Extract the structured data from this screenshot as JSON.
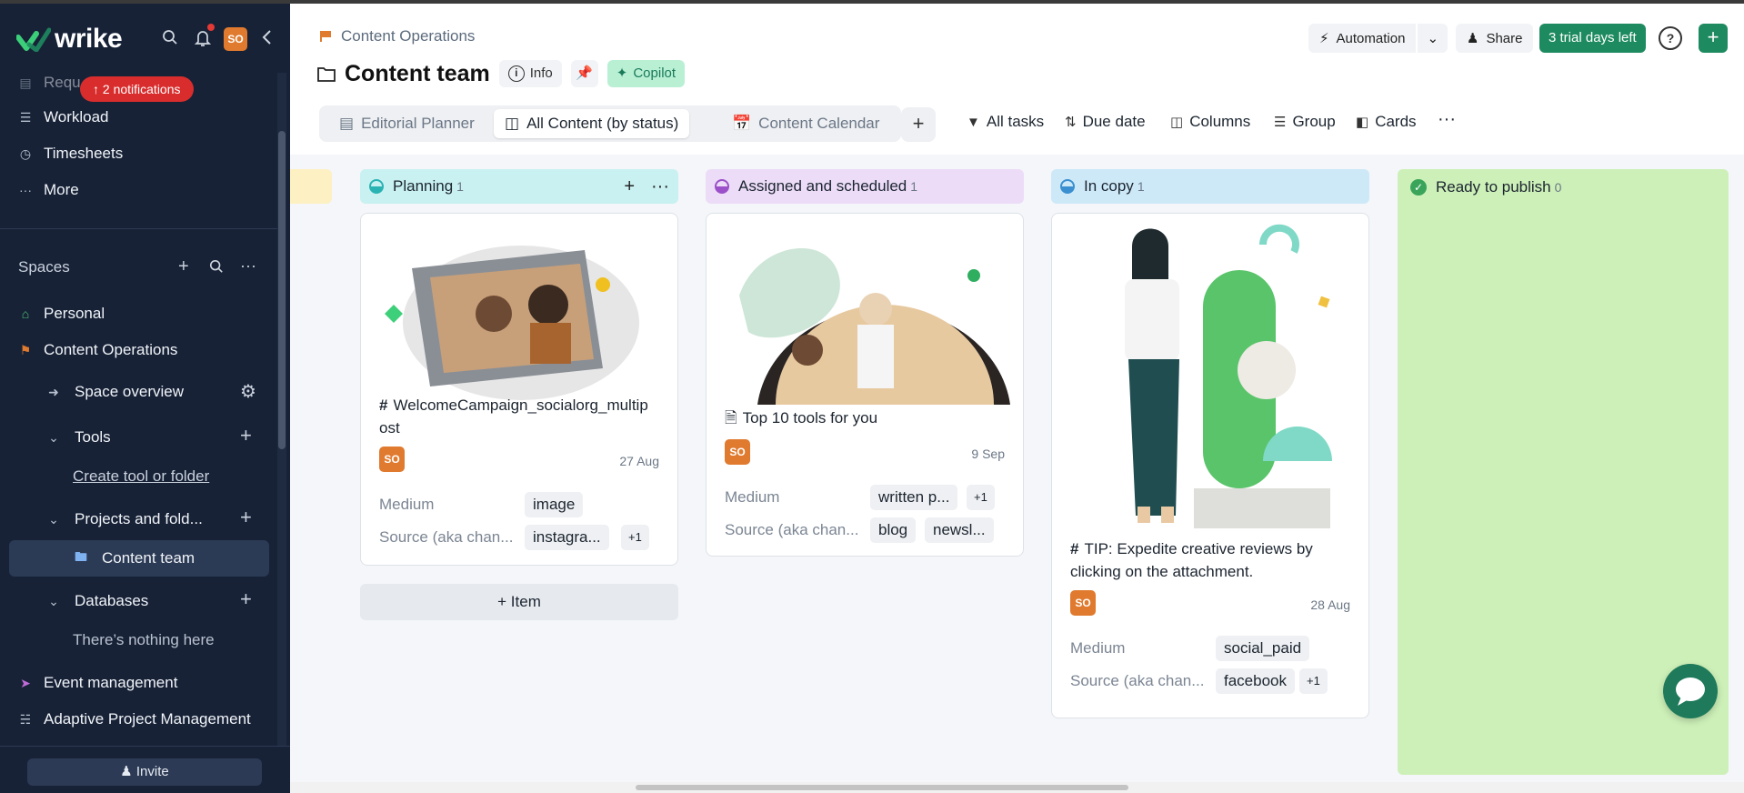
{
  "app": {
    "logo_text": "wrike",
    "accent": "#1e8a5f",
    "sidebar_bg": "#172237"
  },
  "sidebar": {
    "avatar": "SO",
    "notifications_pill": "2 notifications",
    "partial_item": "Requ",
    "items": [
      {
        "label": "Workload",
        "icon": "workload-icon"
      },
      {
        "label": "Timesheets",
        "icon": "timesheets-icon"
      },
      {
        "label": "More",
        "icon": "more-dots-icon"
      }
    ],
    "spaces_label": "Spaces",
    "spaces": [
      {
        "label": "Personal",
        "icon": "home-icon"
      },
      {
        "label": "Content Operations",
        "icon": "flag-icon"
      }
    ],
    "space_overview": "Space overview",
    "tools": "Tools",
    "create_tool": "Create tool or folder",
    "projects": "Projects and fold...",
    "content_team": "Content team",
    "databases": "Databases",
    "nothing_here": "There’s nothing here",
    "event_management": "Event management",
    "adaptive": "Adaptive Project Management",
    "invite": "Invite"
  },
  "header": {
    "breadcrumb": "Content Operations",
    "title": "Content team",
    "info": "Info",
    "copilot": "Copilot",
    "automation": "Automation",
    "share": "Share",
    "trial": "3 trial days left",
    "help": "?",
    "add": "+"
  },
  "tabs": [
    {
      "label": "Editorial Planner"
    },
    {
      "label": "All Content (by status)"
    },
    {
      "label": "Content Calendar"
    }
  ],
  "toolbar": {
    "all_tasks": "All tasks",
    "due_date": "Due date",
    "columns": "Columns",
    "group": "Group",
    "cards": "Cards",
    "more": "···"
  },
  "board": {
    "columns": [
      {
        "title": "Planning",
        "count": "1",
        "card": {
          "title": "WelcomeCampaign_socialorg_multip",
          "title2": "ost",
          "avatar": "SO",
          "date": "27 Aug",
          "field1": "Medium",
          "tag1": "image",
          "field2": "Source (aka chan...",
          "tag2": "instagra...",
          "extra": "+1"
        },
        "add_item": "+ Item"
      },
      {
        "title": "Assigned and scheduled",
        "count": "1",
        "card": {
          "title": "Top 10 tools for you",
          "avatar": "SO",
          "date": "9 Sep",
          "field1": "Medium",
          "tag1": "written p...",
          "extra1": "+1",
          "field2": "Source (aka chan...",
          "tag2": "blog",
          "tag3": "newsl..."
        }
      },
      {
        "title": "In copy",
        "count": "1",
        "card": {
          "title": "TIP: Expedite creative reviews by",
          "title2": "clicking on the attachment.",
          "avatar": "SO",
          "date": "28 Aug",
          "field1": "Medium",
          "tag1": "social_paid",
          "field2": "Source (aka chan...",
          "tag2": "facebook",
          "extra": "+1"
        }
      },
      {
        "title": "Ready to publish",
        "count": "0"
      }
    ]
  }
}
